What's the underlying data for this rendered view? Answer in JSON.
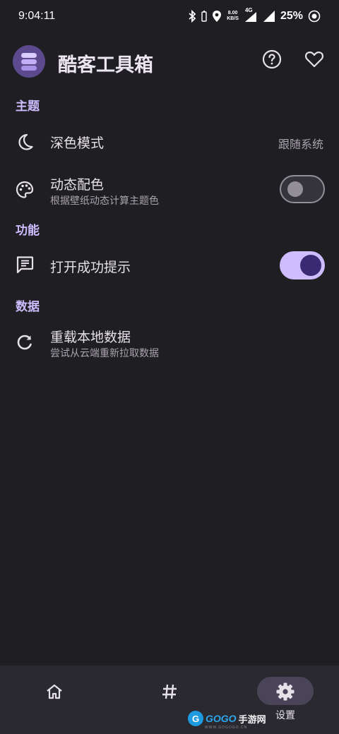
{
  "status_bar": {
    "time": "9:04:11",
    "net_speed_top": "8.00",
    "net_speed_bottom": "KB/S",
    "network_type": "4G",
    "battery": "25%"
  },
  "app_bar": {
    "title": "酷客工具箱",
    "help_icon": "help-circle-icon",
    "favorite_icon": "heart-icon"
  },
  "sections": {
    "theme": {
      "header": "主题",
      "dark_mode": {
        "title": "深色模式",
        "value": "跟随系统"
      },
      "dynamic_color": {
        "title": "动态配色",
        "subtitle": "根据壁纸动态计算主题色",
        "enabled": false
      }
    },
    "features": {
      "header": "功能",
      "open_success_tip": {
        "title": "打开成功提示",
        "enabled": true
      }
    },
    "data": {
      "header": "数据",
      "reload_local_data": {
        "title": "重载本地数据",
        "subtitle": "尝试从云端重新拉取数据"
      }
    }
  },
  "bottom_nav": {
    "items": [
      {
        "icon": "home-icon",
        "label": ""
      },
      {
        "icon": "hashtag-icon",
        "label": ""
      },
      {
        "icon": "gear-icon",
        "label": "设置",
        "selected": true
      }
    ]
  },
  "watermark": {
    "logo_letter": "G",
    "brand": "GOGO",
    "brand_cn": "手游网",
    "url": "WWW.GOGOGO.CN"
  },
  "colors": {
    "background": "#1f1e22",
    "accent": "#cdbdff",
    "switch_on_knob": "#3a2a74",
    "nav_background": "#2b2930"
  }
}
